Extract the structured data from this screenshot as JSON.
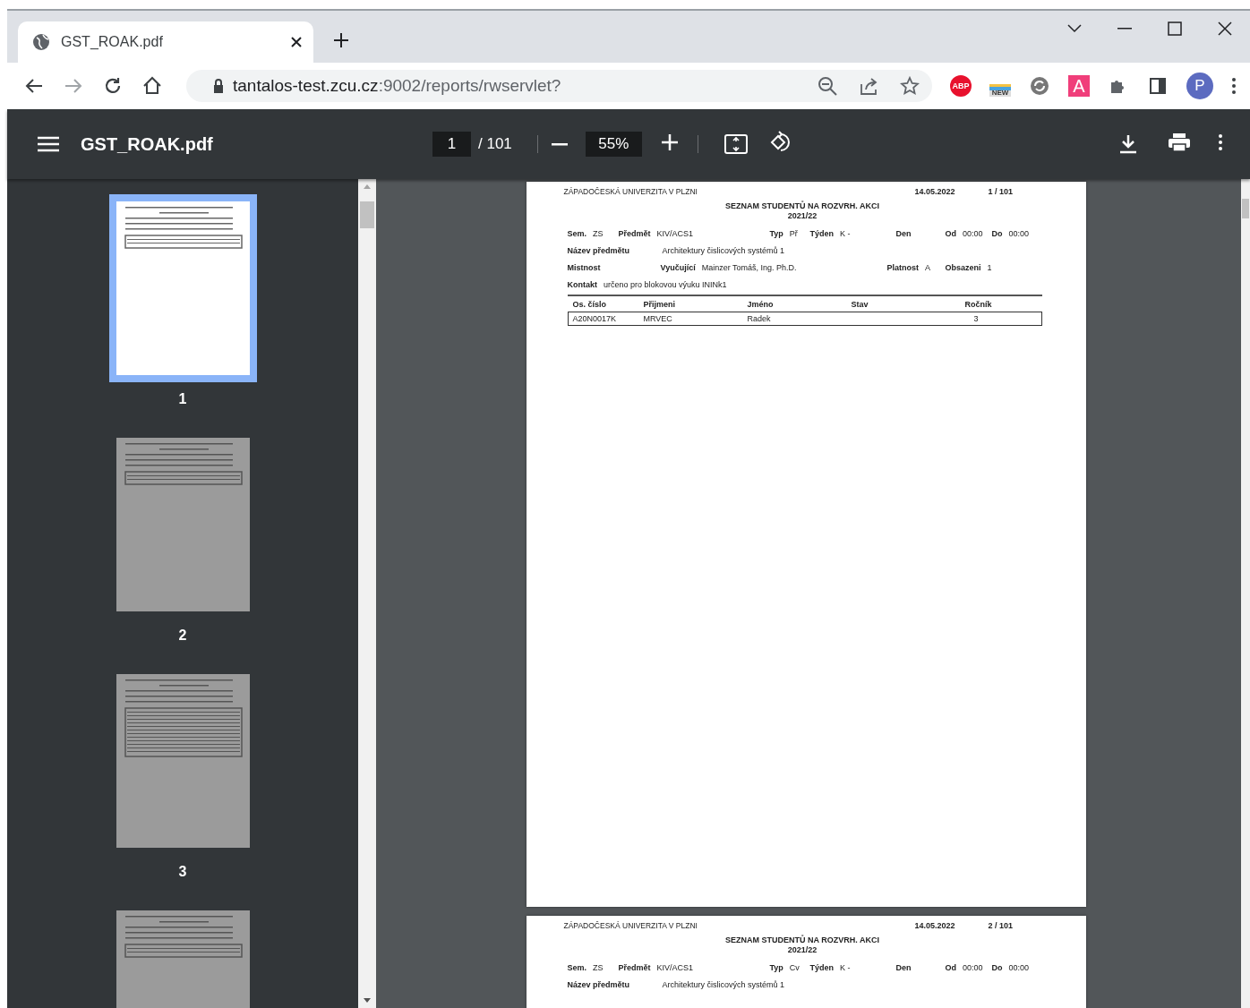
{
  "browser": {
    "tabs": [
      {
        "title": "GST_ROAK.pdf",
        "selected": true
      }
    ],
    "address": {
      "host": "tantalos-test.zcu.cz",
      "path": ":9002/reports/rwservlet?"
    },
    "extensions": [
      {
        "kind": "abp",
        "label": "ABP"
      },
      {
        "kind": "new",
        "label": "NEW"
      },
      {
        "kind": "sync"
      },
      {
        "kind": "letter",
        "label": "A"
      },
      {
        "kind": "puzzle"
      },
      {
        "kind": "panel"
      }
    ],
    "avatar": "P"
  },
  "viewer": {
    "title": "GST_ROAK.pdf",
    "page": "1",
    "page_total": "/ 101",
    "zoom": "55%"
  },
  "thumbnails": [
    {
      "label": "1",
      "selected": true,
      "kind": "short"
    },
    {
      "label": "2",
      "selected": false,
      "kind": "short"
    },
    {
      "label": "3",
      "selected": false,
      "kind": "long"
    },
    {
      "selected": false,
      "kind": "short"
    }
  ],
  "pages": [
    {
      "university": "ZÁPADOČESKÁ UNIVERZITA V PLZNI",
      "date": "14.05.2022",
      "page_no": "1 / 101",
      "title": "SEZNAM STUDENTŮ NA ROZVRH. AKCI",
      "year": "2021/22",
      "info_lines": [
        {
          "fields": [
            {
              "label": "Sem.",
              "value": "ZS"
            },
            {
              "label": "Předmět",
              "value": "KIV/ACS1"
            },
            {
              "label": "Typ",
              "value": "Př"
            },
            {
              "label": "Týden",
              "value": "K   -"
            },
            {
              "label": "Den"
            },
            {
              "label": "Od",
              "value": "00:00"
            },
            {
              "label": "Do",
              "value": "00:00"
            }
          ]
        },
        {
          "fields": [
            {
              "label": "Název předmětu",
              "value": "Architektury čislicových systémů 1"
            }
          ]
        },
        {
          "fields": [
            {
              "label": "Mistnost"
            },
            {
              "label": "Vyučující",
              "value": "Mainzer Tomáš, Ing. Ph.D."
            },
            {
              "label": "Platnost",
              "value": "A"
            },
            {
              "label": "Obsazeni",
              "value": "1"
            }
          ]
        },
        {
          "fields": [
            {
              "label": "Kontakt",
              "value": "určeno pro blokovou výuku ININk1"
            }
          ]
        }
      ],
      "table": {
        "columns": [
          "Os. číslo",
          "Přijmeni",
          "Jméno",
          "Stav",
          "Ročník"
        ],
        "rows": [
          [
            "A20N0017K",
            "MRVEC",
            "Radek",
            null,
            "3"
          ]
        ]
      }
    },
    {
      "university": "ZÁPADOČESKÁ UNIVERZITA V PLZNI",
      "date": "14.05.2022",
      "page_no": "2 / 101",
      "title": "SEZNAM STUDENTŮ NA ROZVRH. AKCI",
      "year": "2021/22",
      "info_lines": [
        {
          "fields": [
            {
              "label": "Sem.",
              "value": "ZS"
            },
            {
              "label": "Předmět",
              "value": "KIV/ACS1"
            },
            {
              "label": "Typ",
              "value": "Cv"
            },
            {
              "label": "Týden",
              "value": "K   -"
            },
            {
              "label": "Den"
            },
            {
              "label": "Od",
              "value": "00:00"
            },
            {
              "label": "Do",
              "value": "00:00"
            }
          ]
        },
        {
          "fields": [
            {
              "label": "Název předmětu",
              "value": "Architektury čislicových systémů 1"
            }
          ]
        }
      ]
    }
  ]
}
